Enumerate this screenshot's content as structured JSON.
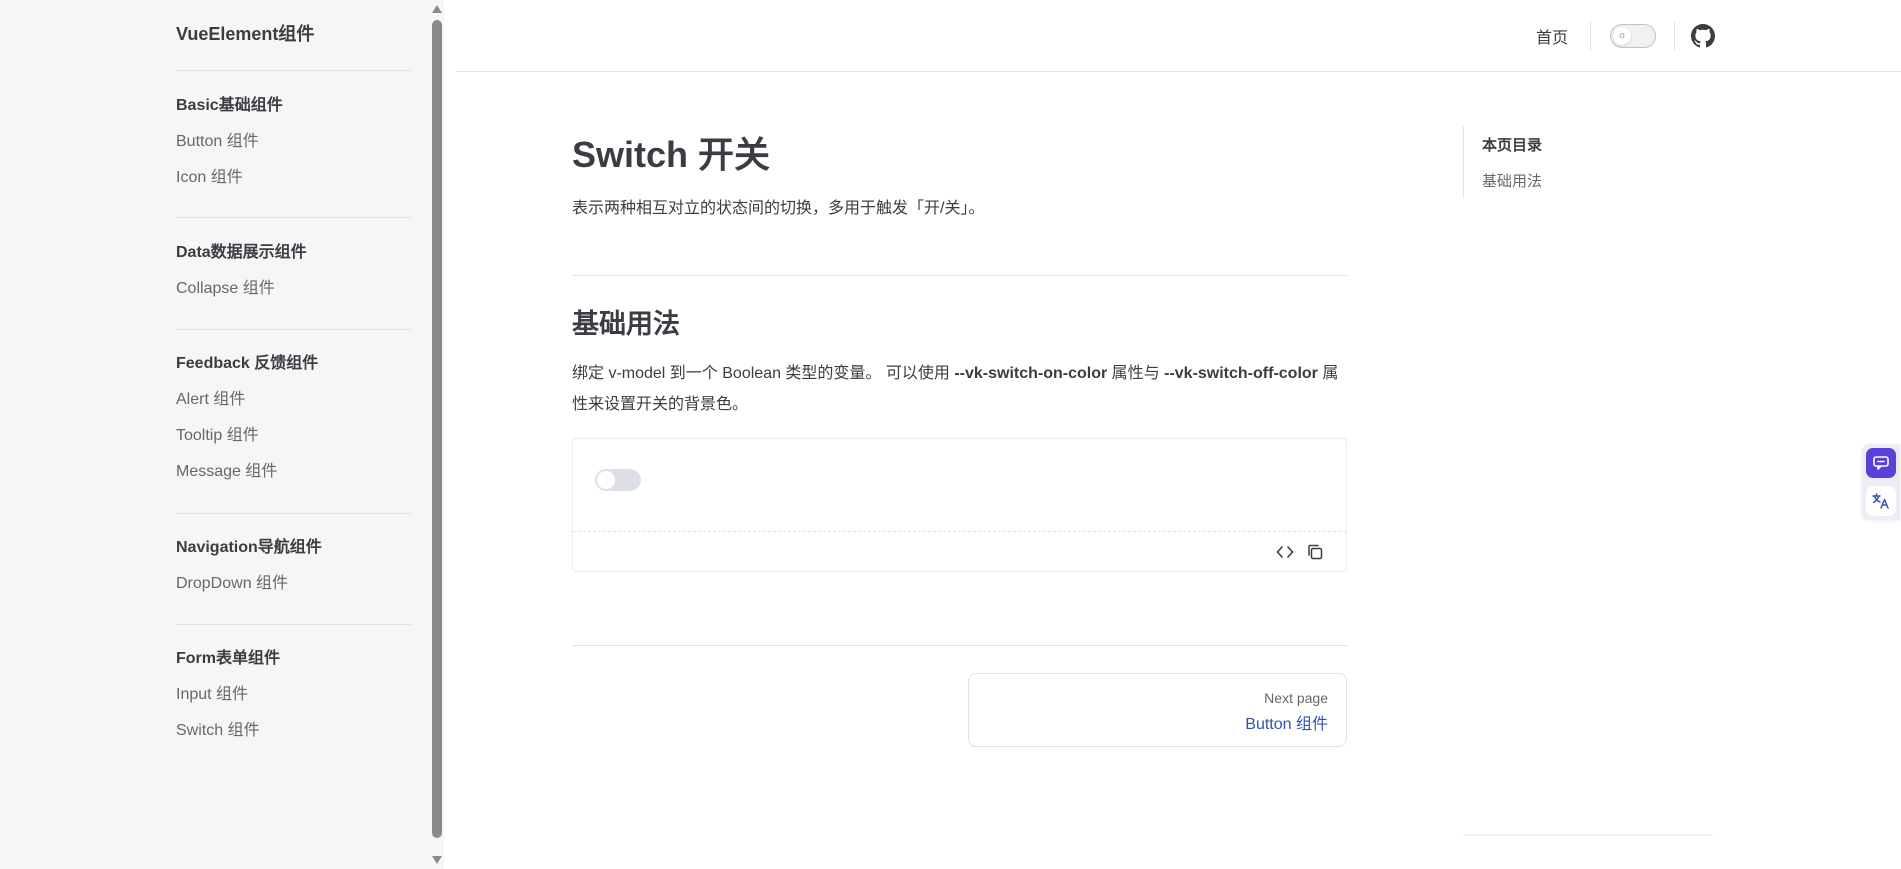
{
  "sidebar": {
    "title": "VueElement组件",
    "groups": [
      {
        "title": "Basic基础组件",
        "items": [
          "Button 组件",
          "Icon 组件"
        ]
      },
      {
        "title": "Data数据展示组件",
        "items": [
          "Collapse 组件"
        ]
      },
      {
        "title": "Feedback 反馈组件",
        "items": [
          "Alert 组件",
          "Tooltip 组件",
          "Message 组件"
        ]
      },
      {
        "title": "Navigation导航组件",
        "items": [
          "DropDown 组件"
        ]
      },
      {
        "title": "Form表单组件",
        "items": [
          "Input 组件",
          "Switch 组件"
        ]
      }
    ]
  },
  "header": {
    "home_label": "首页",
    "theme_icon": "sun-icon",
    "github_icon": "github-icon"
  },
  "main": {
    "title": "Switch 开关",
    "description": "表示两种相互对立的状态间的切换，多用于触发「开/关」。",
    "section": {
      "title": "基础用法",
      "desc_prefix": "绑定 v-model 到一个 Boolean 类型的变量。 可以使用 ",
      "desc_bold1": "--vk-switch-on-color",
      "desc_mid": " 属性与 ",
      "desc_bold2": "--vk-switch-off-color",
      "desc_suffix": " 属性来设置开关的背景色。"
    },
    "demo": {
      "switch_on": false,
      "tool_icons": [
        "code-icon",
        "copy-icon"
      ]
    },
    "next": {
      "label": "Next page",
      "link": "Button 组件"
    }
  },
  "outline": {
    "title": "本页目录",
    "items": [
      "基础用法"
    ]
  },
  "colors": {
    "brand": "#3451b2",
    "widget_accent": "#5b3fd9",
    "sidebar_bg": "#f6f6f7"
  }
}
